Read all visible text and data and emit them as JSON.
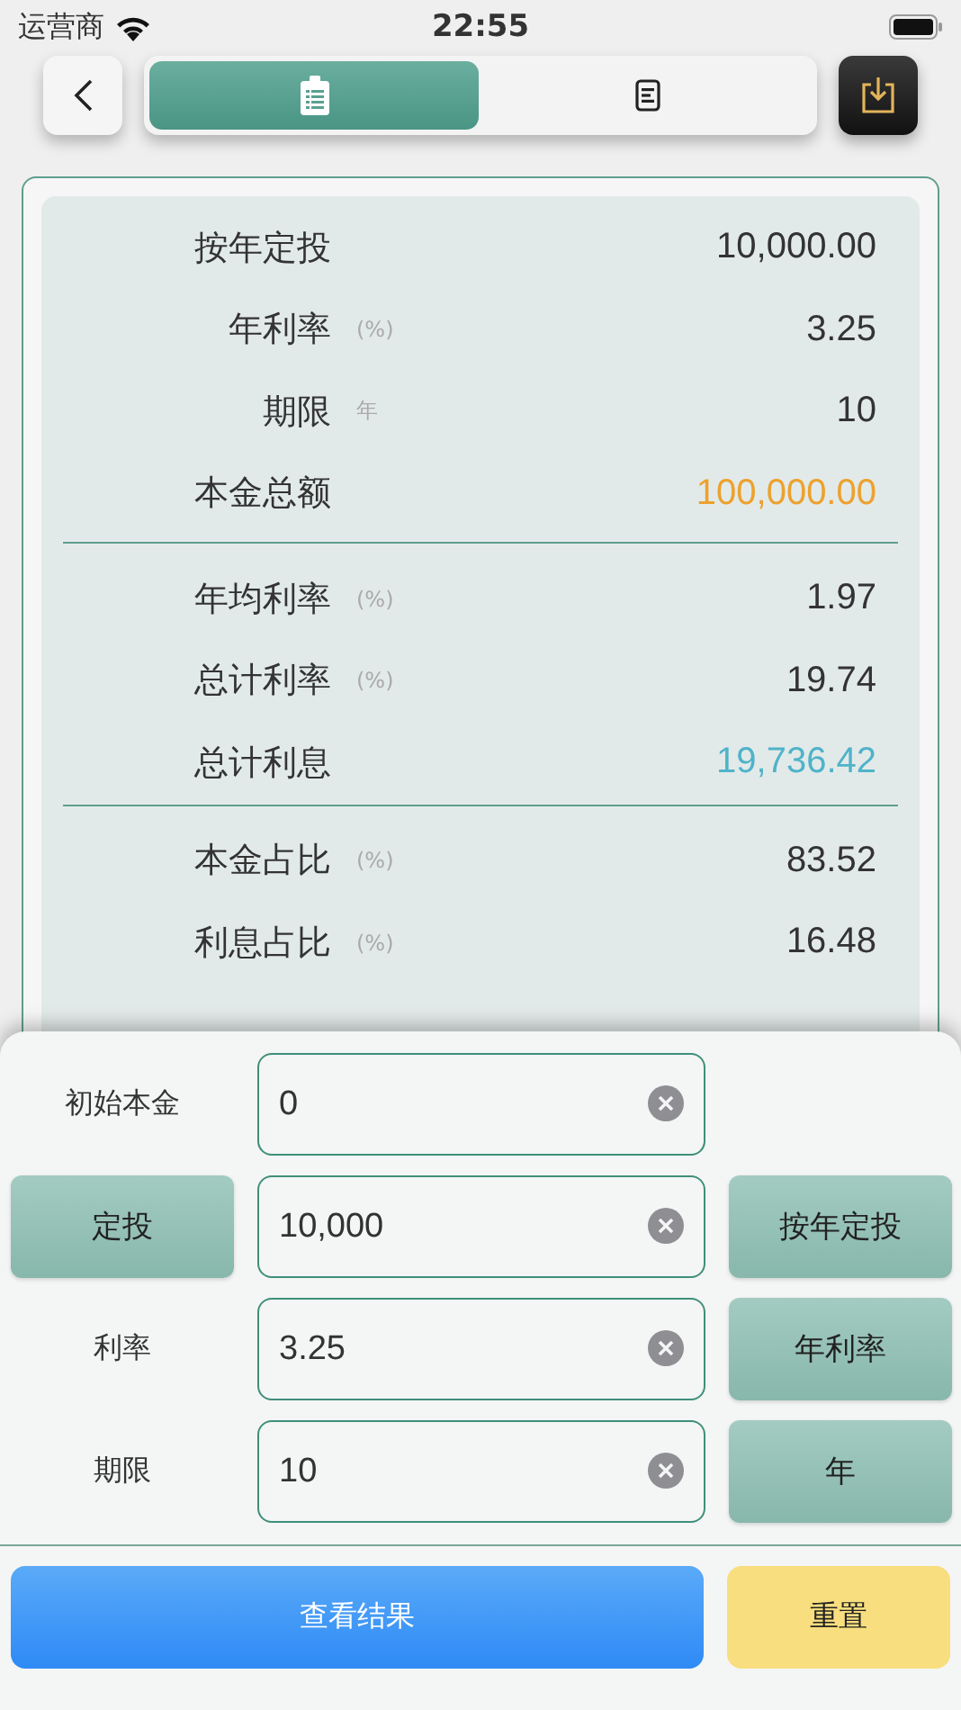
{
  "status_bar": {
    "carrier": "运营商",
    "time": "22:55"
  },
  "segments": [
    {
      "selected": true
    },
    {
      "selected": false
    }
  ],
  "summary": {
    "groups": [
      [
        {
          "label": "按年定投",
          "value": "10,000.00"
        },
        {
          "label": "年利率",
          "unit": "(%)",
          "value": "3.25"
        },
        {
          "label": "期限",
          "unit": "年",
          "value": "10"
        },
        {
          "label": "本金总额",
          "value": "100,000.00",
          "color": "#eda12e"
        }
      ],
      [
        {
          "label": "年均利率",
          "unit": "(%)",
          "value": "1.97"
        },
        {
          "label": "总计利率",
          "unit": "(%)",
          "value": "19.74"
        },
        {
          "label": "总计利息",
          "value": "19,736.42",
          "color": "#4fb3c9"
        }
      ],
      [
        {
          "label": "本金占比",
          "unit": "(%)",
          "value": "83.52"
        },
        {
          "label": "利息占比",
          "unit": "(%)",
          "value": "16.48"
        }
      ]
    ]
  },
  "form": [
    {
      "kind": "text",
      "label": "初始本金",
      "value": "0"
    },
    {
      "kind": "button",
      "label": "定投",
      "value": "10,000",
      "option": "按年定投"
    },
    {
      "kind": "text",
      "label": "利率",
      "value": "3.25",
      "option": "年利率"
    },
    {
      "kind": "text",
      "label": "期限",
      "value": "10",
      "option": "年"
    }
  ],
  "actions": [
    {
      "kind": "primary",
      "label": "查看结果"
    },
    {
      "kind": "secondary",
      "label": "重置"
    }
  ]
}
